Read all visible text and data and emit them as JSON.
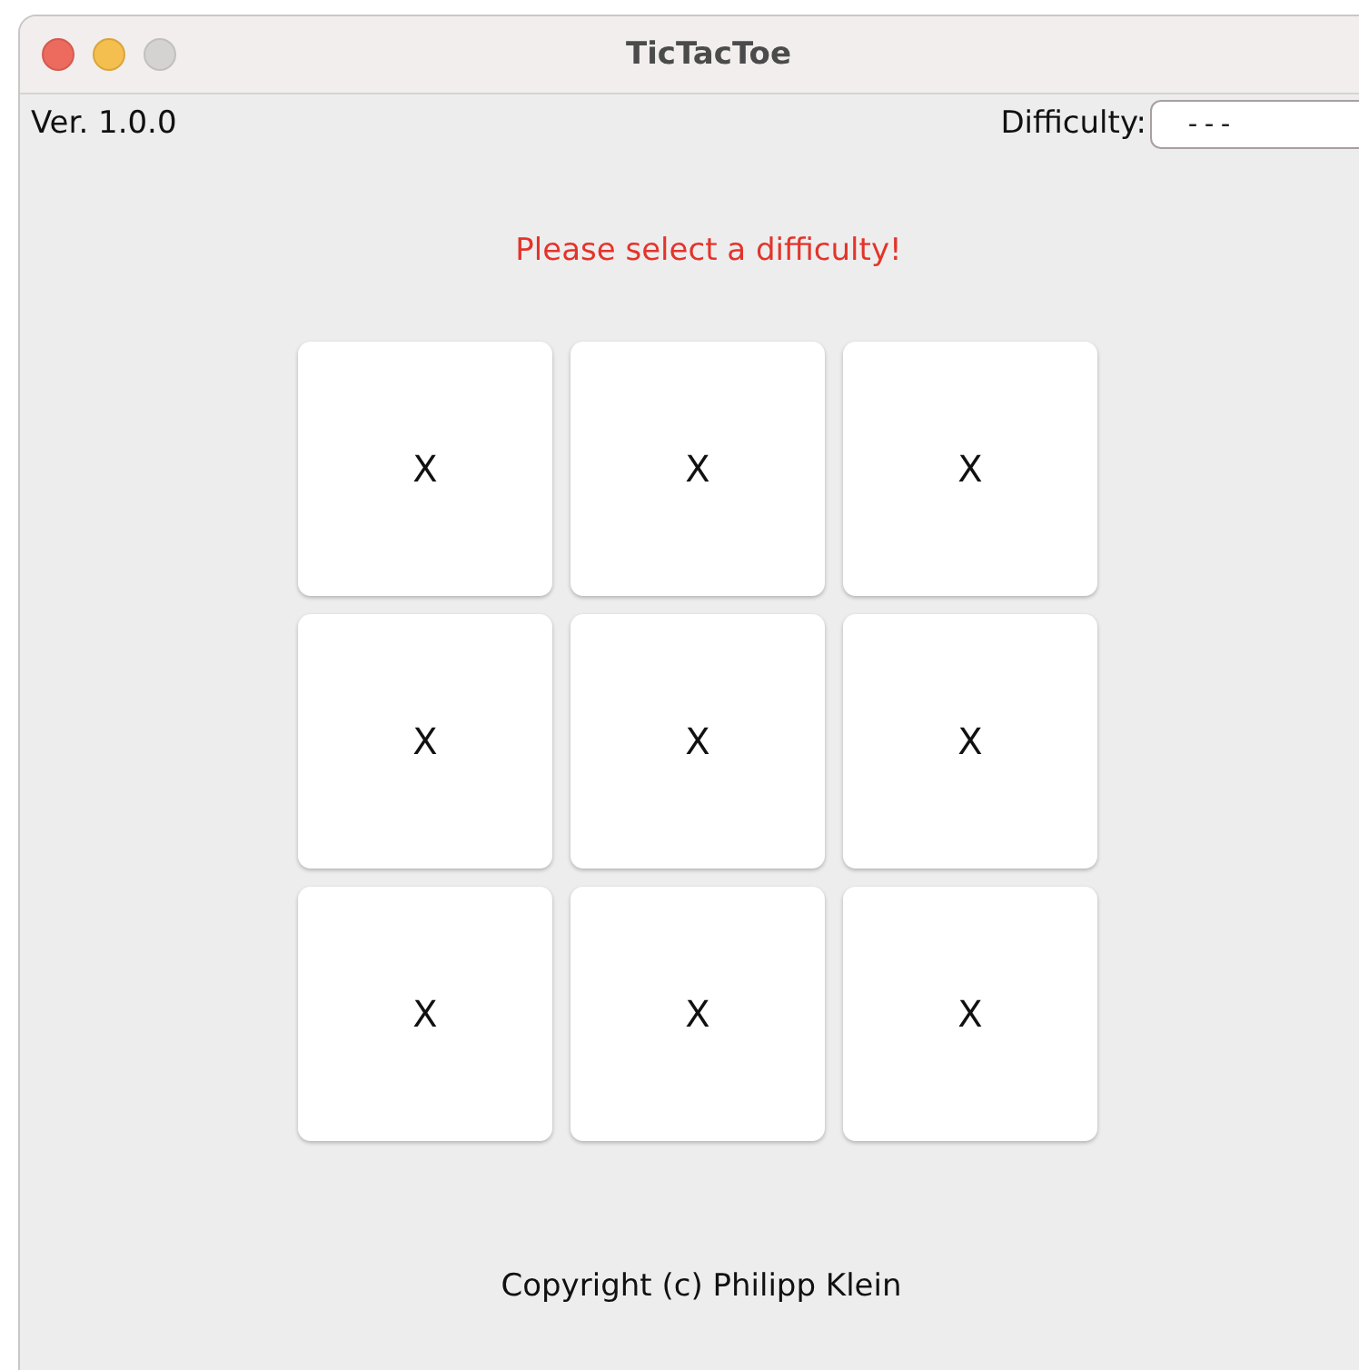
{
  "window": {
    "title": "TicTacToe"
  },
  "version": "Ver. 1.0.0",
  "difficulty": {
    "label": "Difficulty:",
    "value": "---"
  },
  "message": "Please select a difficulty!",
  "board": [
    {
      "mark": "X"
    },
    {
      "mark": "X"
    },
    {
      "mark": "X"
    },
    {
      "mark": "X"
    },
    {
      "mark": "X"
    },
    {
      "mark": "X"
    },
    {
      "mark": "X"
    },
    {
      "mark": "X"
    },
    {
      "mark": "X"
    }
  ],
  "copyright": "Copyright (c) Philipp Klein"
}
